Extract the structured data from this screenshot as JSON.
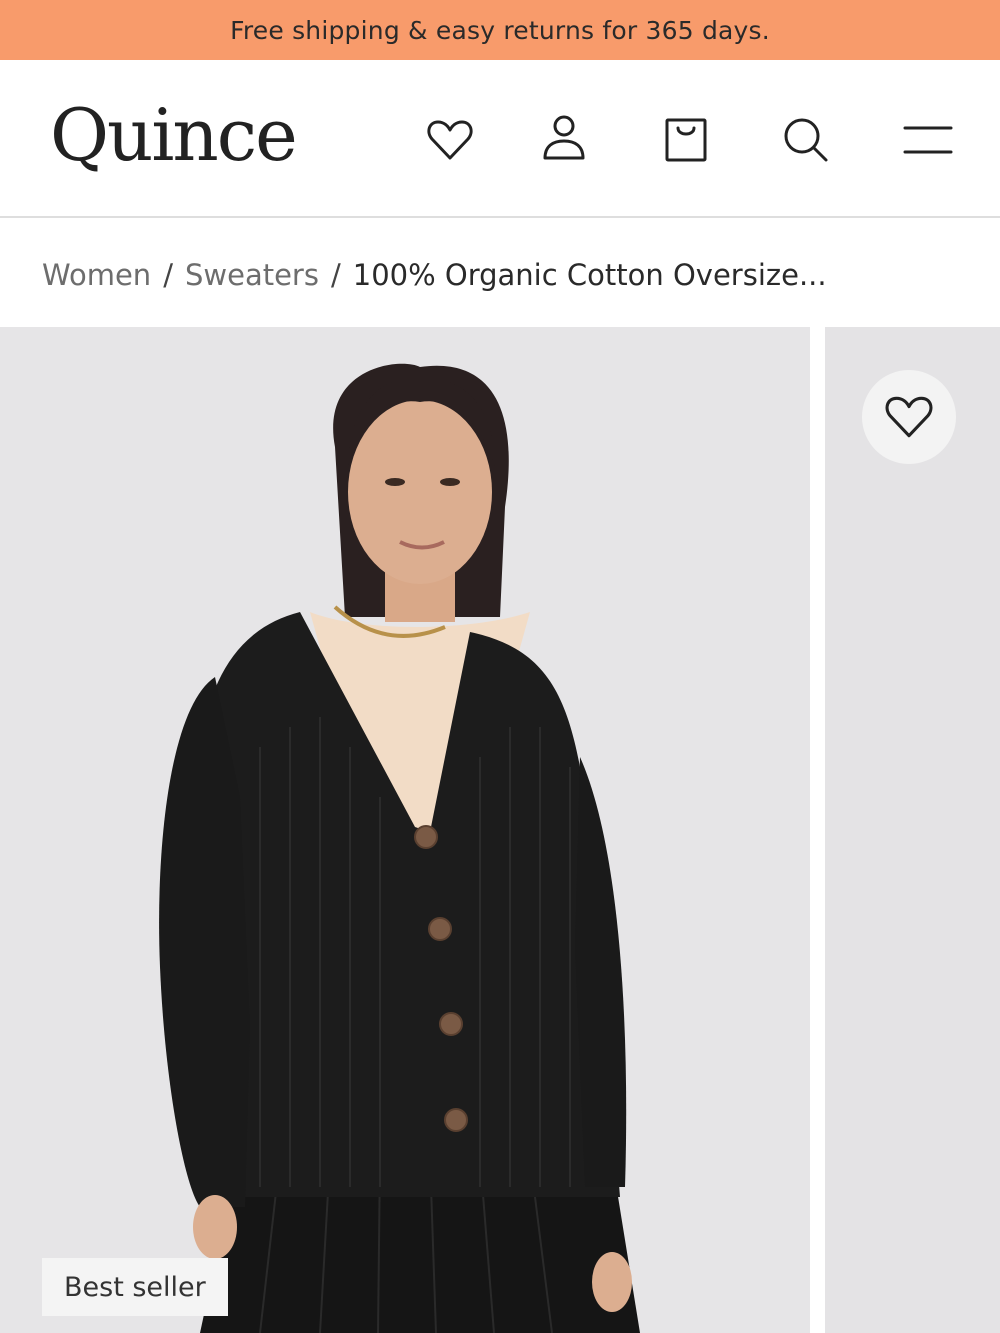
{
  "promo": {
    "text": "Free shipping & easy returns for 365 days."
  },
  "colors": {
    "promo_bg": "#f89b6b",
    "image_bg": "#e6e5e7",
    "sweater": "#1c1c1c"
  },
  "header": {
    "logo": "Quince",
    "icons": [
      "heart-icon",
      "user-icon",
      "shopping-bag-icon",
      "search-icon",
      "menu-icon"
    ]
  },
  "breadcrumb": {
    "items": [
      "Women",
      "Sweaters"
    ],
    "separator": "/",
    "current": "100% Organic Cotton Oversize..."
  },
  "product": {
    "badge": "Best seller",
    "image_description_icon": "product-photo"
  }
}
